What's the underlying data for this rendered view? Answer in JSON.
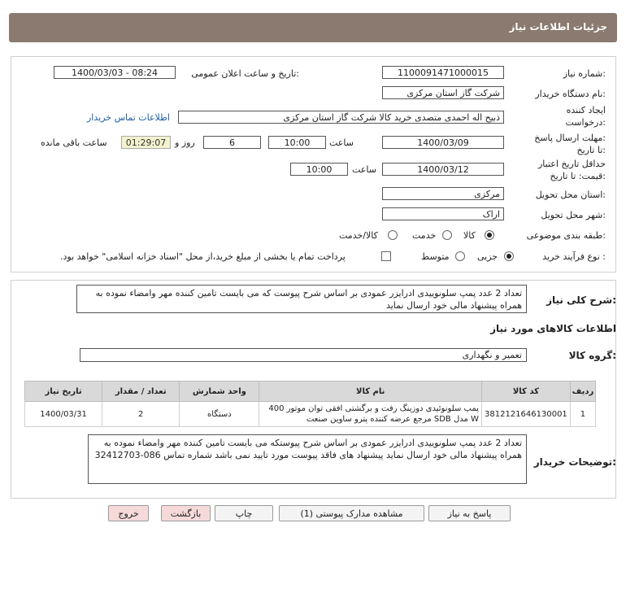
{
  "header": {
    "title": "جزئیات اطلاعات نیاز"
  },
  "form": {
    "need_number_label": "شماره نیاز:",
    "need_number": "1100091471000015",
    "announce_label": "تاریخ و ساعت اعلان عمومی:",
    "announce_value": "1400/03/03 - 08:24",
    "buyer_org_label": "نام دستگاه خریدار:",
    "buyer_org": "شرکت گاز استان مرکزی",
    "creator_label_1": "ایجاد کننده",
    "creator_label_2": "درخواست:",
    "creator": "ذبیح اله احمدی متصدی خرید کالا شرکت گاز استان مرکزی",
    "contact_link": "اطلاعات تماس خریدار",
    "reply_label_1": "مهلت ارسال پاسخ:",
    "reply_label_2": "تا تاریخ:",
    "reply_date": "1400/03/09",
    "time_label": "ساعت",
    "reply_time": "10:00",
    "days_value": "6",
    "days_label": "روز و",
    "remaining_value": "01:29:07",
    "remaining_label": "ساعت باقی مانده",
    "validity_label_1": "حداقل تاریخ اعتبار",
    "validity_label_2": "قیمت: تا تاریخ:",
    "validity_date": "1400/03/12",
    "validity_time": "10:00",
    "province_label": "استان محل تحویل:",
    "province": "مرکزی",
    "city_label": "شهر محل تحویل:",
    "city": "اراک",
    "category_label": "طبقه بندی موضوعی:",
    "cat_goods": "کالا",
    "cat_service": "خدمت",
    "cat_goods_service": "کالا/خدمت",
    "process_label": "نوع فرآیند خرید :",
    "proc_minor": "جزیی",
    "proc_medium": "متوسط",
    "payment_note": "پرداخت تمام یا بخشی از مبلغ خرید،از محل \"اسناد خزانه اسلامی\" خواهد بود."
  },
  "details": {
    "summary_label": "شرح کلی نیاز:",
    "summary": "تعداد 2 عدد پمپ سلونوییدی ادرایزر عمودی  بر اساس شرح پیوست که می بایست تامین کننده مهر وامضاء نموده به همراه پیشنهاد مالی خود ارسال نماید",
    "goods_info_title": "اطلاعات کالاهای مورد نیاز",
    "goods_group_label": "گروه کالا:",
    "goods_group": "تعمیر و نگهداری",
    "table": {
      "headers": [
        "ردیف",
        "کد کالا",
        "نام کالا",
        "واحد شمارش",
        "تعداد / مقدار",
        "تاریخ نیاز"
      ],
      "rows": [
        [
          "1",
          "3812121646130001",
          "پمپ سلونوئیدی دوزینگ رفت و برگشتی افقی توان موتور 400 W مدل SDB مرجع عرضه کننده پترو ساوین صنعت",
          "دستگاه",
          "2",
          "1400/03/31"
        ]
      ]
    },
    "buyer_notes_label": "توضیحات خریدار:",
    "buyer_notes": "تعداد 2 عدد پمپ سلونوییدی ادرایزر عمودی  بر اساس شرح پیوستکه می بایست تامین کننده مهر وامضاء نموده به همراه پیشنهاد مالی خود ارسال نماید پیشنهاد های فاقد پیوست مورد تایید نمی باشد شماره تماس 086-32412703"
  },
  "buttons": {
    "reply": "پاسخ به نیاز",
    "view_docs": "مشاهده مدارک پیوستی (1)",
    "print": "چاپ",
    "back": "بازگشت",
    "exit": "خروج"
  }
}
